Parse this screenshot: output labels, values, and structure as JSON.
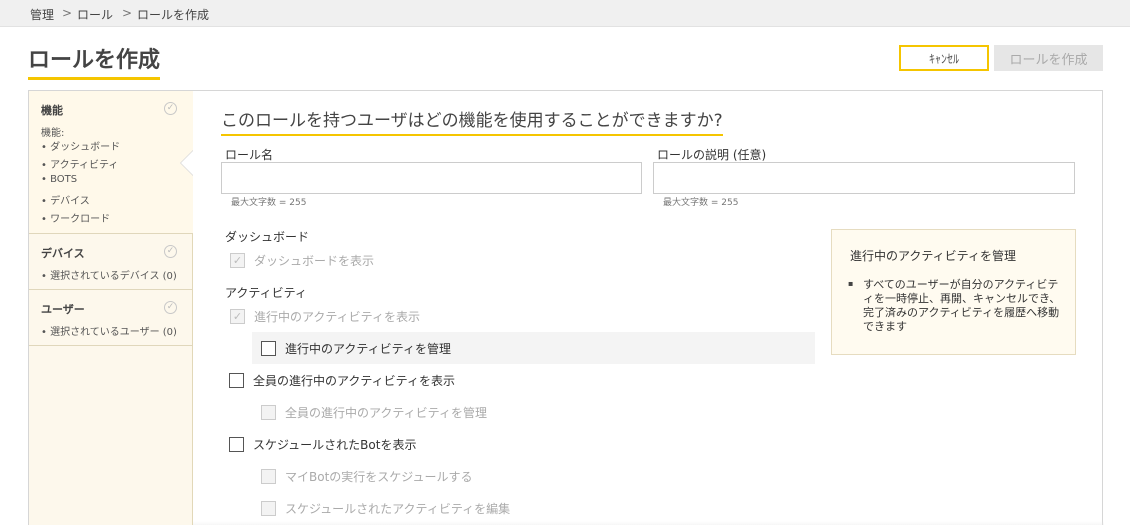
{
  "breadcrumb": {
    "item1": "管理",
    "sep1": ">",
    "item2": "ロール",
    "sep2": ">",
    "item3": "ロールを作成"
  },
  "page": {
    "title": "ロールを作成"
  },
  "actions": {
    "cancel_label": "ｷｬﾝｾﾙ",
    "create_label": "ロールを作成"
  },
  "sidebar": {
    "features": {
      "title": "機能",
      "subtitle": "機能:",
      "items": [
        "ダッシュボード",
        "アクティビティ",
        "BOTS",
        "デバイス",
        "ワークロード"
      ]
    },
    "devices": {
      "title": "デバイス",
      "selected": "選択されているデバイス (0)"
    },
    "users": {
      "title": "ユーザー",
      "selected": "選択されているユーザー (0)"
    },
    "check_icon": "check-circle-icon"
  },
  "main": {
    "heading": "このロールを持つユーザはどの機能を使用することができますか?",
    "role_name": {
      "label": "ロール名",
      "value": "",
      "hint": "最大文字数 = 255"
    },
    "role_desc": {
      "label": "ロールの説明 (任意)",
      "value": "",
      "hint": "最大文字数 = 255"
    },
    "dashboard": {
      "title": "ダッシュボード",
      "view": "ダッシュボードを表示"
    },
    "activity": {
      "title": "アクティビティ",
      "view_in_progress": "進行中のアクティビティを表示",
      "manage_in_progress": "進行中のアクティビティを管理",
      "view_all_in_progress": "全員の進行中のアクティビティを表示",
      "manage_all_in_progress": "全員の進行中のアクティビティを管理",
      "view_scheduled_bots": "スケジュールされたBotを表示",
      "schedule_my_bots": "マイBotの実行をスケジュールする",
      "edit_scheduled_activity": "スケジュールされたアクティビティを編集"
    }
  },
  "info": {
    "title": "進行中のアクティビティを管理",
    "bullet": "▪",
    "text": "すべてのユーザーが自分のアクティビティを一時停止、再開、キャンセルでき、完了済みのアクティビティを履歴へ移動できます"
  },
  "checkmark": "✓",
  "colors": {
    "accent": "#f5c500",
    "sidebar_bg": "#fdf8ec"
  }
}
